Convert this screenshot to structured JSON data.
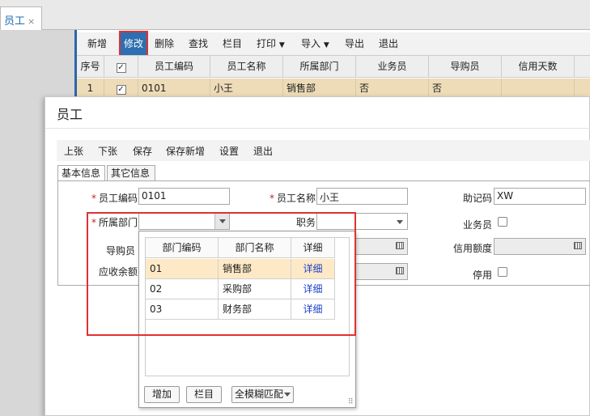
{
  "tab": {
    "title": "员工",
    "close": "×"
  },
  "main_toolbar": {
    "items": [
      "新增",
      "修改",
      "删除",
      "查找",
      "栏目",
      "打印",
      "导入",
      "导出",
      "退出"
    ]
  },
  "grid": {
    "headers": [
      "序号",
      "",
      "员工编码",
      "员工名称",
      "所属部门",
      "业务员",
      "导购员",
      "信用天数"
    ],
    "row": {
      "seq": "1",
      "code": "0101",
      "name": "小王",
      "dept": "销售部",
      "salesman": "否",
      "guide": "否"
    }
  },
  "dialog": {
    "title": "员工",
    "toolbar": [
      "上张",
      "下张",
      "保存",
      "保存新增",
      "设置",
      "退出"
    ],
    "tabs": [
      "基本信息",
      "其它信息"
    ],
    "form": {
      "emp_code_label": "员工编码",
      "emp_code_value": "0101",
      "emp_name_label": "员工名称",
      "emp_name_value": "小王",
      "mnemonic_label": "助记码",
      "mnemonic_value": "XW",
      "dept_label": "所属部门",
      "dept_value": "",
      "position_label": "职务",
      "position_value": "",
      "salesman_label": "业务员",
      "guide_label": "导购员",
      "credit_limit_label": "信用额度",
      "receivable_label": "应收余额",
      "disabled_label": "停用"
    }
  },
  "dept_dropdown": {
    "headers": [
      "部门编码",
      "部门名称",
      "详细"
    ],
    "rows": [
      {
        "code": "01",
        "name": "销售部",
        "detail": "详细"
      },
      {
        "code": "02",
        "name": "采购部",
        "detail": "详细"
      },
      {
        "code": "03",
        "name": "财务部",
        "detail": "详细"
      }
    ],
    "add_button": "增加",
    "columns_button": "栏目",
    "match_mode": "全模糊匹配"
  },
  "colors": {
    "accent": "#2d6fb0",
    "highlight": "#e03131",
    "selected_row": "#eedcb8",
    "link": "#1a3fc7"
  }
}
